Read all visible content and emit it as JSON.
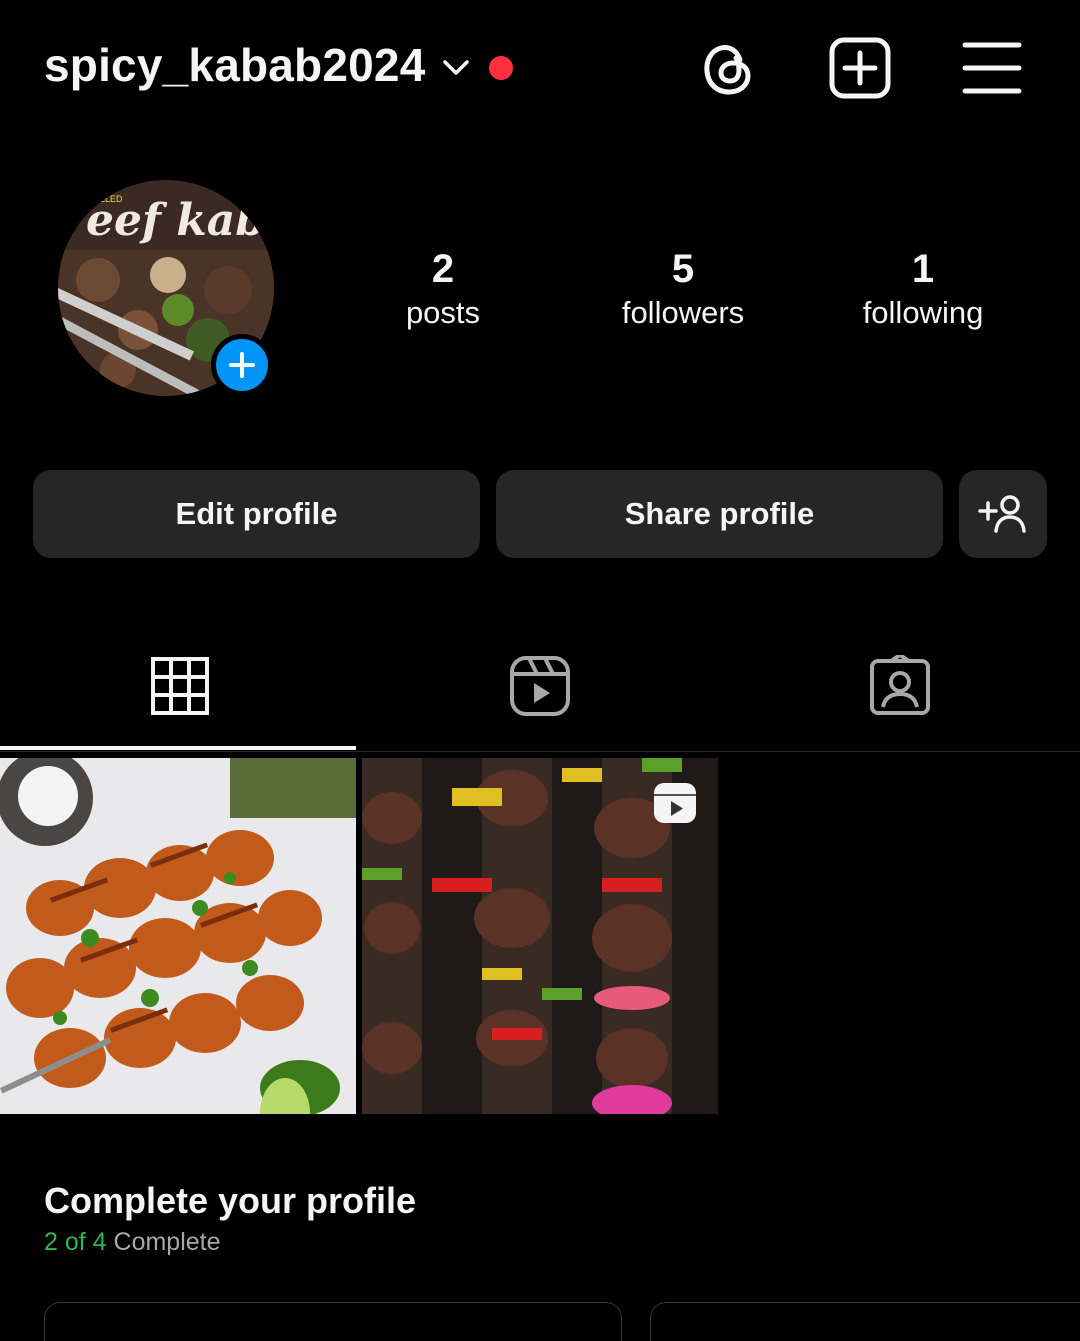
{
  "header": {
    "username": "spicy_kabab2024",
    "icons": [
      "chevron-down-icon",
      "threads-icon",
      "new-post-icon",
      "menu-icon"
    ],
    "notification_dot_color": "#ff3040"
  },
  "profile": {
    "avatar_text": "eef kabob",
    "avatar_badge_text": "LLED",
    "stats": [
      {
        "value": "2",
        "label": "posts"
      },
      {
        "value": "5",
        "label": "followers"
      },
      {
        "value": "1",
        "label": "following"
      }
    ]
  },
  "buttons": {
    "edit": "Edit profile",
    "share": "Share profile",
    "discover_icon": "add-person-icon"
  },
  "tabs": [
    {
      "icon": "grid-icon",
      "selected": true
    },
    {
      "icon": "reels-icon",
      "selected": false
    },
    {
      "icon": "tagged-icon",
      "selected": false
    }
  ],
  "posts": [
    {
      "subject": "chicken-skewers-image",
      "type": "photo"
    },
    {
      "subject": "beef-kabob-image",
      "type": "reel"
    }
  ],
  "complete_profile": {
    "title": "Complete your profile",
    "progress": "2 of 4",
    "status": "Complete"
  },
  "colors": {
    "accent_blue": "#0095f6",
    "progress_green": "#2db84d",
    "button_bg": "#262626"
  }
}
